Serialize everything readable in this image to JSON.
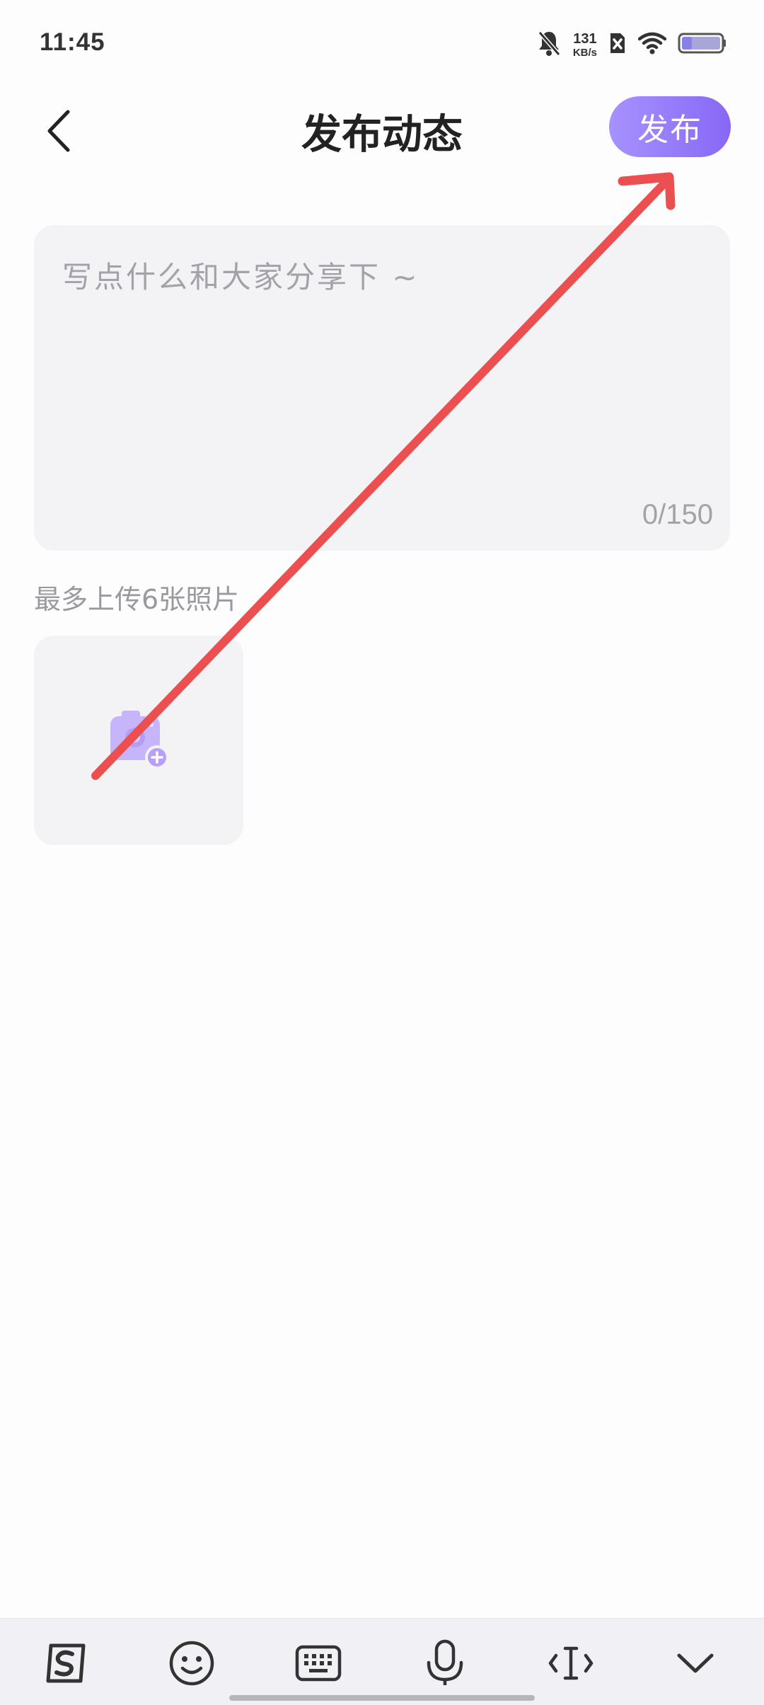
{
  "status_bar": {
    "time": "11:45",
    "net_speed_value": "131",
    "net_speed_unit": "KB/s",
    "icons": [
      "bell-muted-icon",
      "no-sim-icon",
      "wifi-icon",
      "battery-icon"
    ],
    "battery_level": 0.25
  },
  "header": {
    "title": "发布动态",
    "publish_label": "发布",
    "back_icon": "chevron-left-icon"
  },
  "post_input": {
    "placeholder": "写点什么和大家分享下 ~",
    "value": "",
    "counter": "0/150"
  },
  "upload": {
    "hint": "最多上传6张照片",
    "icon": "add-photo-icon"
  },
  "keyboard_toolbar": {
    "icons": [
      "sogou-logo-icon",
      "emoji-icon",
      "keyboard-icon",
      "microphone-icon",
      "cursor-move-icon",
      "collapse-keyboard-icon"
    ]
  },
  "annotation": {
    "color": "#ec4f4f"
  },
  "colors": {
    "accent_start": "#a792ff",
    "accent_end": "#8768f5",
    "input_bg": "#f3f2f5"
  }
}
